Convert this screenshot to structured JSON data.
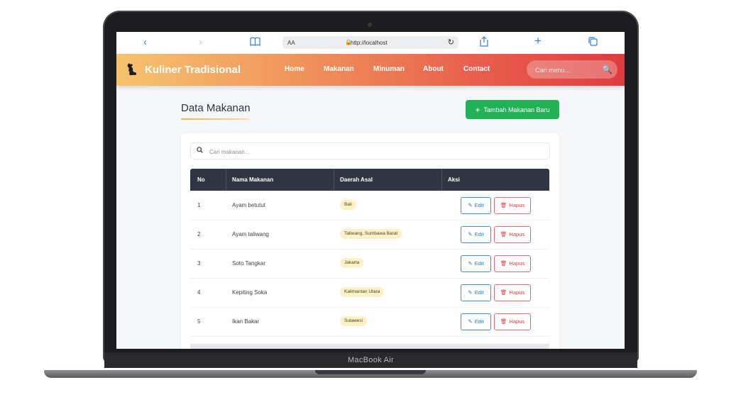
{
  "device": {
    "label": "MacBook Air"
  },
  "browser": {
    "text_size_label": "AA",
    "url": "http://localhost",
    "icons": [
      "back-icon",
      "forward-icon",
      "book-icon",
      "lock-icon",
      "reload-icon",
      "share-icon",
      "new-tab-icon",
      "tabs-icon"
    ]
  },
  "navbar": {
    "brand": "Kuliner Tradisional",
    "links": [
      "Home",
      "Makanan",
      "Minuman",
      "About",
      "Contact"
    ],
    "search_placeholder": "Cari menu...",
    "gradient": [
      "#f6c36f",
      "#e03b3e"
    ]
  },
  "page": {
    "title": "Data Makanan",
    "add_button": "Tambah Makanan Baru",
    "table_search_placeholder": "Cari makanan...",
    "columns": [
      "No",
      "Nama Makanan",
      "Daerah Asal",
      "Aksi"
    ],
    "rows": [
      {
        "no": "1",
        "nama": "Ayam betutut",
        "daerah": "Bali"
      },
      {
        "no": "2",
        "nama": "Ayam taliwang",
        "daerah": "Taliwang, Sumbawa Barat"
      },
      {
        "no": "3",
        "nama": "Soto Tangkar",
        "daerah": "Jakarta"
      },
      {
        "no": "4",
        "nama": "Kepiting Soka",
        "daerah": "Kalimantan Utara"
      },
      {
        "no": "5",
        "nama": "Ikan Bakar",
        "daerah": "Sulawesi"
      }
    ],
    "edit_label": "Edit",
    "delete_label": "Hapus",
    "colors": {
      "add": "#22b156",
      "header": "#2f3543",
      "edit": "#2f7ec4",
      "delete": "#d8413f",
      "badge": "#fdf1c8"
    }
  }
}
